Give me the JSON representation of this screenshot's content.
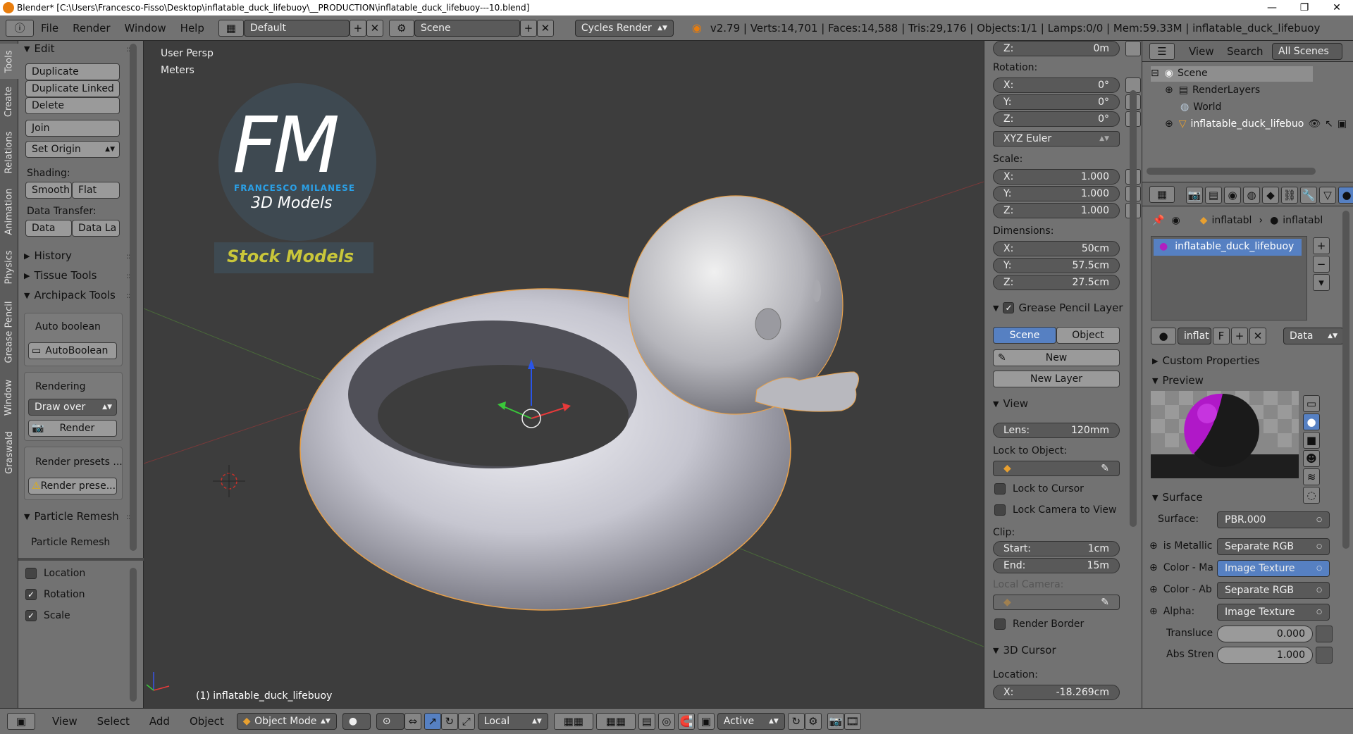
{
  "window": {
    "title": "Blender* [C:\\Users\\Francesco-Fisso\\Desktop\\inflatable_duck_lifebuoy\\__PRODUCTION\\inflatable_duck_lifebuoy---10.blend]",
    "minimize": "—",
    "maximize": "❐",
    "close": "✕"
  },
  "header": {
    "menus": [
      "File",
      "Render",
      "Window",
      "Help"
    ],
    "screen_layout": "Default",
    "scene": "Scene",
    "render_engine": "Cycles Render",
    "stats": "v2.79 | Verts:14,701 | Faces:14,588 | Tris:29,176 | Objects:1/1 | Lamps:0/0 | Mem:59.33M | inflatable_duck_lifebuoy"
  },
  "vertical_tabs": [
    "Tools",
    "Create",
    "Relations",
    "Animation",
    "Physics",
    "Grease Pencil",
    "Window",
    "Graswald"
  ],
  "toolshelf": {
    "edit_title": "Edit",
    "duplicate": "Duplicate",
    "duplicate_linked": "Duplicate Linked",
    "delete": "Delete",
    "join": "Join",
    "set_origin": "Set Origin",
    "shading_label": "Shading:",
    "smooth": "Smooth",
    "flat": "Flat",
    "data_transfer_label": "Data Transfer:",
    "data": "Data",
    "data_la": "Data La",
    "history": "History",
    "tissue_tools": "Tissue Tools",
    "archipack": "Archipack Tools",
    "auto_boolean_label": "Auto boolean",
    "autoboolean_btn": "AutoBoolean",
    "rendering_label": "Rendering",
    "draw_over": "Draw over",
    "render_btn": "Render",
    "render_presets_label": "Render presets ...",
    "render_presets_btn": "Render prese...",
    "particle_remesh_title": "Particle Remesh",
    "particle_remesh_label": "Particle Remesh",
    "location": "Location",
    "rotation": "Rotation",
    "scale": "Scale"
  },
  "viewport": {
    "view_name": "User Persp",
    "units": "Meters",
    "logo_fm": "FM",
    "logo_name": "FRANCESCO MILANESE",
    "logo_sub": "3D Models",
    "stock_label": "Stock Models",
    "object_label": "(1) inflatable_duck_lifebuoy"
  },
  "npanel": {
    "loc_z_label": "Z:",
    "loc_z": "0m",
    "rotation_label": "Rotation:",
    "rot": [
      {
        "axis": "X:",
        "val": "0°"
      },
      {
        "axis": "Y:",
        "val": "0°"
      },
      {
        "axis": "Z:",
        "val": "0°"
      }
    ],
    "euler": "XYZ Euler",
    "scale_label": "Scale:",
    "scale": [
      {
        "axis": "X:",
        "val": "1.000"
      },
      {
        "axis": "Y:",
        "val": "1.000"
      },
      {
        "axis": "Z:",
        "val": "1.000"
      }
    ],
    "dimensions_label": "Dimensions:",
    "dims": [
      {
        "axis": "X:",
        "val": "50cm"
      },
      {
        "axis": "Y:",
        "val": "57.5cm"
      },
      {
        "axis": "Z:",
        "val": "27.5cm"
      }
    ],
    "grease_pencil": "Grease Pencil Layer",
    "gp_scene": "Scene",
    "gp_object": "Object",
    "gp_new": "New",
    "gp_new_layer": "New Layer",
    "view_title": "View",
    "lens_label": "Lens:",
    "lens": "120mm",
    "lock_to_object": "Lock to Object:",
    "lock_to_cursor": "Lock to Cursor",
    "lock_camera": "Lock Camera to View",
    "clip_label": "Clip:",
    "clip_start_label": "Start:",
    "clip_start": "1cm",
    "clip_end_label": "End:",
    "clip_end": "15m",
    "local_camera": "Local Camera:",
    "render_border": "Render Border",
    "cursor_title": "3D Cursor",
    "cursor_location": "Location:",
    "cursor_x_label": "X:",
    "cursor_x": "-18.269cm"
  },
  "outliner": {
    "view": "View",
    "search": "Search",
    "scope": "All Scenes",
    "items": [
      "Scene",
      "RenderLayers",
      "World",
      "inflatable_duck_lifebuo"
    ]
  },
  "properties": {
    "crumb_obj": "inflatabl",
    "crumb_mat": "inflatabl",
    "material_slot": "inflatable_duck_lifebuoy",
    "mat_name": "inflat",
    "mat_f": "F",
    "link": "Data",
    "custom_props": "Custom Properties",
    "preview": "Preview",
    "surface_title": "Surface",
    "surface_label": "Surface:",
    "surface_value": "PBR.000",
    "inputs": [
      {
        "label": "is Metallic",
        "value": "Separate RGB"
      },
      {
        "label": "Color - Ma",
        "value": "Image Texture"
      },
      {
        "label": "Color - Ab",
        "value": "Separate RGB"
      },
      {
        "label": "Alpha:",
        "value": "Image Texture"
      }
    ],
    "translucency_label": "Transluce",
    "translucency": "0.000",
    "abs_strength_label": "Abs Stren",
    "abs_strength": "1.000"
  },
  "bottombar": {
    "view": "View",
    "select": "Select",
    "add": "Add",
    "object": "Object",
    "mode": "Object Mode",
    "orientation": "Local",
    "pivot_active": "Active"
  },
  "colors": {
    "panel": "#727272",
    "viewport": "#3d3d3d",
    "selection_blue": "#5680c2",
    "logo_blue": "#2aa1e8",
    "stock_yellow": "#c9c63a",
    "outline_orange": "#e7a04a"
  }
}
